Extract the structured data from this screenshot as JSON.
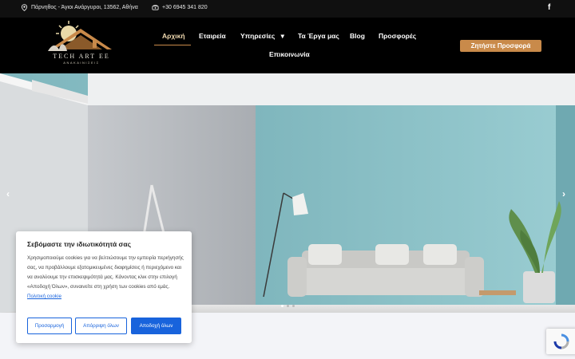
{
  "topbar": {
    "address": "Πάρνηθος - Άγιοι Ανάργυροι, 13562, Αθήνα",
    "phone": "+30 6945 341 820",
    "social_icon": "f"
  },
  "logo": {
    "name": "TECH ART EE",
    "tagline": "ΑΝΑΚΑΙΝΙΣΕΙΣ"
  },
  "nav": {
    "items": [
      {
        "label": "Αρχική"
      },
      {
        "label": "Εταιρεία"
      },
      {
        "label": "Υπηρεσίες"
      },
      {
        "label": "Τα Έργα μας"
      },
      {
        "label": "Blog"
      },
      {
        "label": "Προσφορές"
      },
      {
        "label": "Επικοινωνία"
      }
    ],
    "dropdown_glyph": "▾",
    "cta_label": "Ζητήστε Προσφορά"
  },
  "hero": {
    "prev_glyph": "‹",
    "next_glyph": "›"
  },
  "cookie": {
    "title": "Σεβόμαστε την ιδιωτικότητά σας",
    "body": "Χρησιμοποιούμε cookies για να βελτιώσουμε την εμπειρία περιήγησής σας, να προβάλλουμε εξατομικευμένες διαφημίσεις ή περιεχόμενο και να αναλύουμε την επισκεψιμότητά μας. Κάνοντας κλικ στην επιλογή «Αποδοχή Όλων», συναινείτε στη χρήση των cookies από εμάς.",
    "link": "Πολιτική cookie",
    "btn_customize": "Προσαρμογή",
    "btn_reject": "Απόρριψη όλων",
    "btn_accept": "Αποδοχή όλων"
  },
  "colors": {
    "accent": "#c98a4a",
    "cookie_blue": "#1863dc",
    "header_bg": "#000000"
  }
}
